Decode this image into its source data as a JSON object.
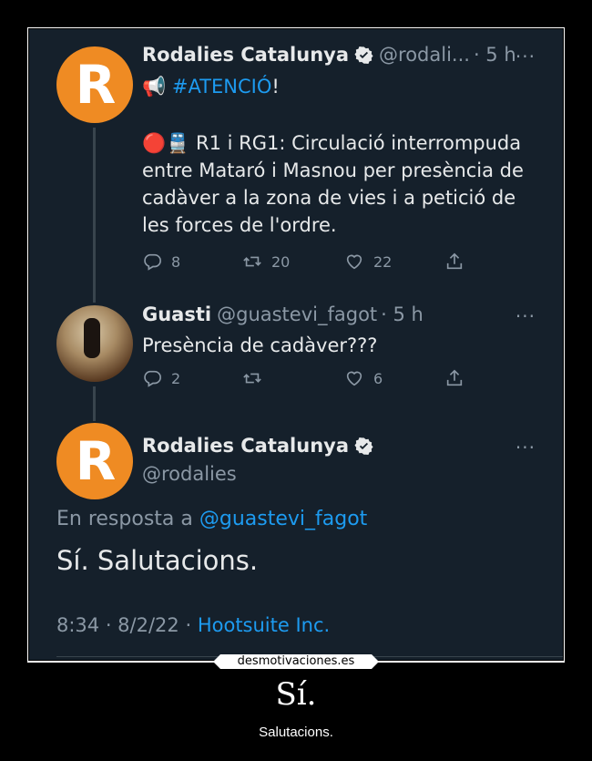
{
  "tweet1": {
    "avatar_letter": "R",
    "name": "Rodalies Catalunya",
    "handle": "@rodali...",
    "time": "· 5 h",
    "more": "···",
    "line1_prefix": "📢",
    "line1_hashtag": "#ATENCIÓ",
    "line1_suffix": "!",
    "emoji": "🔴🚆",
    "text_lines": [
      "R1 i RG1: Circulació interrompuda",
      "entre Mataró i Masnou per presència de",
      "cadàver a la zona de vies i a petició de",
      "les forces de l'ordre."
    ],
    "replies": "8",
    "retweets": "20",
    "likes": "22"
  },
  "tweet2": {
    "name": "Guasti",
    "handle": "@guastevi_fagot",
    "time": "· 5 h",
    "more": "···",
    "text": "Presència de cadàver???",
    "replies": "2",
    "retweets": "",
    "likes": "6"
  },
  "tweet3": {
    "avatar_letter": "R",
    "name": "Rodalies Catalunya",
    "handle": "@rodalies",
    "more": "···",
    "reply_prefix": "En resposta a",
    "reply_handle": "@guastevi_fagot",
    "text": "Sí. Salutacions.",
    "timestamp": "8:34 · 8/2/22 ·",
    "source": "Hootsuite Inc."
  },
  "watermark": "desmotivaciones.es",
  "caption": {
    "title": "Sí.",
    "subtitle": "Salutacions."
  },
  "colors": {
    "background": "#15202b",
    "link": "#1d9bf0",
    "brand_orange": "#ef8b23",
    "muted": "#8b98a5"
  }
}
